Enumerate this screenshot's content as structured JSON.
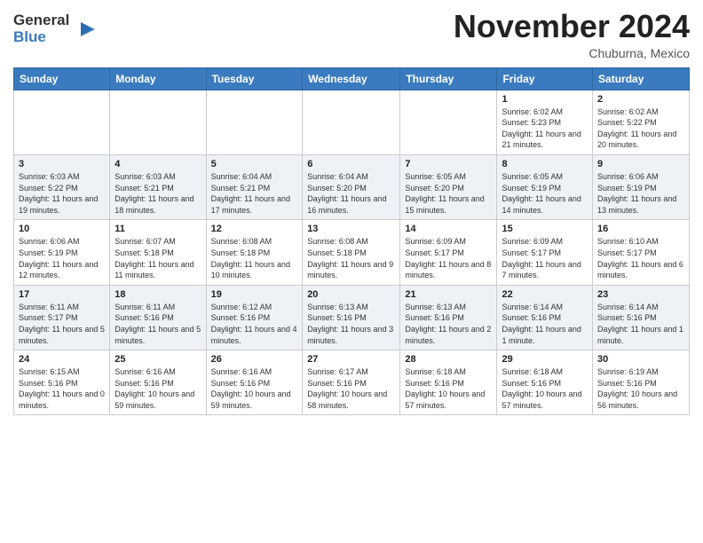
{
  "header": {
    "logo_general": "General",
    "logo_blue": "Blue",
    "month_title": "November 2024",
    "location": "Chuburna, Mexico"
  },
  "weekdays": [
    "Sunday",
    "Monday",
    "Tuesday",
    "Wednesday",
    "Thursday",
    "Friday",
    "Saturday"
  ],
  "weeks": [
    [
      {
        "day": "",
        "info": ""
      },
      {
        "day": "",
        "info": ""
      },
      {
        "day": "",
        "info": ""
      },
      {
        "day": "",
        "info": ""
      },
      {
        "day": "",
        "info": ""
      },
      {
        "day": "1",
        "info": "Sunrise: 6:02 AM\nSunset: 5:23 PM\nDaylight: 11 hours and 21 minutes."
      },
      {
        "day": "2",
        "info": "Sunrise: 6:02 AM\nSunset: 5:22 PM\nDaylight: 11 hours and 20 minutes."
      }
    ],
    [
      {
        "day": "3",
        "info": "Sunrise: 6:03 AM\nSunset: 5:22 PM\nDaylight: 11 hours and 19 minutes."
      },
      {
        "day": "4",
        "info": "Sunrise: 6:03 AM\nSunset: 5:21 PM\nDaylight: 11 hours and 18 minutes."
      },
      {
        "day": "5",
        "info": "Sunrise: 6:04 AM\nSunset: 5:21 PM\nDaylight: 11 hours and 17 minutes."
      },
      {
        "day": "6",
        "info": "Sunrise: 6:04 AM\nSunset: 5:20 PM\nDaylight: 11 hours and 16 minutes."
      },
      {
        "day": "7",
        "info": "Sunrise: 6:05 AM\nSunset: 5:20 PM\nDaylight: 11 hours and 15 minutes."
      },
      {
        "day": "8",
        "info": "Sunrise: 6:05 AM\nSunset: 5:19 PM\nDaylight: 11 hours and 14 minutes."
      },
      {
        "day": "9",
        "info": "Sunrise: 6:06 AM\nSunset: 5:19 PM\nDaylight: 11 hours and 13 minutes."
      }
    ],
    [
      {
        "day": "10",
        "info": "Sunrise: 6:06 AM\nSunset: 5:19 PM\nDaylight: 11 hours and 12 minutes."
      },
      {
        "day": "11",
        "info": "Sunrise: 6:07 AM\nSunset: 5:18 PM\nDaylight: 11 hours and 11 minutes."
      },
      {
        "day": "12",
        "info": "Sunrise: 6:08 AM\nSunset: 5:18 PM\nDaylight: 11 hours and 10 minutes."
      },
      {
        "day": "13",
        "info": "Sunrise: 6:08 AM\nSunset: 5:18 PM\nDaylight: 11 hours and 9 minutes."
      },
      {
        "day": "14",
        "info": "Sunrise: 6:09 AM\nSunset: 5:17 PM\nDaylight: 11 hours and 8 minutes."
      },
      {
        "day": "15",
        "info": "Sunrise: 6:09 AM\nSunset: 5:17 PM\nDaylight: 11 hours and 7 minutes."
      },
      {
        "day": "16",
        "info": "Sunrise: 6:10 AM\nSunset: 5:17 PM\nDaylight: 11 hours and 6 minutes."
      }
    ],
    [
      {
        "day": "17",
        "info": "Sunrise: 6:11 AM\nSunset: 5:17 PM\nDaylight: 11 hours and 5 minutes."
      },
      {
        "day": "18",
        "info": "Sunrise: 6:11 AM\nSunset: 5:16 PM\nDaylight: 11 hours and 5 minutes."
      },
      {
        "day": "19",
        "info": "Sunrise: 6:12 AM\nSunset: 5:16 PM\nDaylight: 11 hours and 4 minutes."
      },
      {
        "day": "20",
        "info": "Sunrise: 6:13 AM\nSunset: 5:16 PM\nDaylight: 11 hours and 3 minutes."
      },
      {
        "day": "21",
        "info": "Sunrise: 6:13 AM\nSunset: 5:16 PM\nDaylight: 11 hours and 2 minutes."
      },
      {
        "day": "22",
        "info": "Sunrise: 6:14 AM\nSunset: 5:16 PM\nDaylight: 11 hours and 1 minute."
      },
      {
        "day": "23",
        "info": "Sunrise: 6:14 AM\nSunset: 5:16 PM\nDaylight: 11 hours and 1 minute."
      }
    ],
    [
      {
        "day": "24",
        "info": "Sunrise: 6:15 AM\nSunset: 5:16 PM\nDaylight: 11 hours and 0 minutes."
      },
      {
        "day": "25",
        "info": "Sunrise: 6:16 AM\nSunset: 5:16 PM\nDaylight: 10 hours and 59 minutes."
      },
      {
        "day": "26",
        "info": "Sunrise: 6:16 AM\nSunset: 5:16 PM\nDaylight: 10 hours and 59 minutes."
      },
      {
        "day": "27",
        "info": "Sunrise: 6:17 AM\nSunset: 5:16 PM\nDaylight: 10 hours and 58 minutes."
      },
      {
        "day": "28",
        "info": "Sunrise: 6:18 AM\nSunset: 5:16 PM\nDaylight: 10 hours and 57 minutes."
      },
      {
        "day": "29",
        "info": "Sunrise: 6:18 AM\nSunset: 5:16 PM\nDaylight: 10 hours and 57 minutes."
      },
      {
        "day": "30",
        "info": "Sunrise: 6:19 AM\nSunset: 5:16 PM\nDaylight: 10 hours and 56 minutes."
      }
    ]
  ]
}
